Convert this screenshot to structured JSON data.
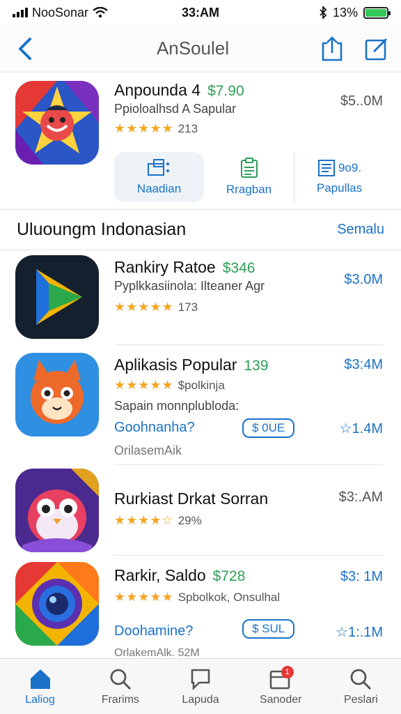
{
  "status": {
    "carrier": "NooSonar",
    "time": "33:AM",
    "battery": "13%"
  },
  "nav": {
    "title": "AnSoulel"
  },
  "featured": {
    "name": "Anpounda 4",
    "price": "$7.90",
    "subtitle": "Ppioloalhsd A Sapular",
    "rating_count": "213",
    "size": "$5..0M",
    "segments": [
      {
        "label": "Naadian",
        "icon": "image-icon"
      },
      {
        "label": "Rragban",
        "icon": "clipboard-icon"
      },
      {
        "label": "Papullas",
        "icon": "document-icon"
      }
    ],
    "segment_extra": "9o9."
  },
  "section": {
    "title": "Uluoungm Indonasian",
    "link": "Semalu"
  },
  "apps": [
    {
      "name": "Rankiry Ratoe",
      "price": "$346",
      "subtitle": "Pyplkkasiinola: Ilteaner Agr",
      "rating_count": "173",
      "size": "$3.0M"
    },
    {
      "name": "Aplikasis Popular",
      "price": "139",
      "subtitle": "$polkinja",
      "desc": "Sapain monnplubloda:",
      "dev": "Goohnanha?",
      "get": "$ 0UE",
      "size": "$3:4M",
      "size2": "☆1.4M",
      "dev2": "OrilasemAik"
    },
    {
      "name": "Rurkiast Drkat Sorran",
      "rating_count": "29%",
      "size": "$3:.AM"
    },
    {
      "name": "Rarkir, Saldo",
      "price": "$728",
      "subtitle": "Spbolkok, Onsulhal",
      "dev": "Doohamine?",
      "get": "$ SUL",
      "size": "$3: 1M",
      "size2": "☆1:.1M",
      "dev2": "OrlakemAlk. 52M"
    }
  ],
  "tabs": [
    {
      "label": "Laliog",
      "icon": "home-icon"
    },
    {
      "label": "Frarims",
      "icon": "search-icon"
    },
    {
      "label": "Lapuda",
      "icon": "chat-icon"
    },
    {
      "label": "Sanoder",
      "icon": "updates-icon",
      "badge": "1"
    },
    {
      "label": "Peslari",
      "icon": "search-icon"
    }
  ],
  "colors": {
    "accent": "#1a72c9",
    "price_green": "#2e9e57",
    "star": "#f5a623",
    "badge": "#e53935"
  }
}
